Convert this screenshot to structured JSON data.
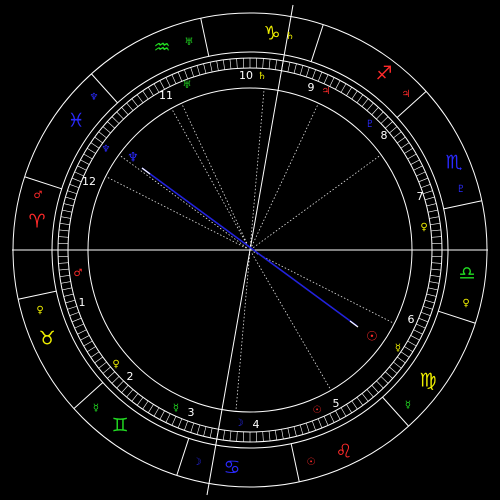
{
  "colors": {
    "background": "#000000",
    "lines": "#ffffff",
    "fire": "#ff2a2a",
    "earth": "#f0f000",
    "air": "#22dd22",
    "water": "#2a2aff",
    "aspect_opposition": "#2222dd"
  },
  "signs": [
    {
      "id": "aries",
      "glyph": "♈",
      "color": "#ff2a2a",
      "ruler": "♂",
      "ruler_color": "#ff2a2a"
    },
    {
      "id": "taurus",
      "glyph": "♉",
      "color": "#f0f000",
      "ruler": "♀",
      "ruler_color": "#f0f000"
    },
    {
      "id": "gemini",
      "glyph": "♊",
      "color": "#22dd22",
      "ruler": "☿",
      "ruler_color": "#22dd22"
    },
    {
      "id": "cancer",
      "glyph": "♋",
      "color": "#2a2aff",
      "ruler": "☽",
      "ruler_color": "#2a2aff"
    },
    {
      "id": "leo",
      "glyph": "♌",
      "color": "#ff2a2a",
      "ruler": "☉",
      "ruler_color": "#ff2a2a"
    },
    {
      "id": "virgo",
      "glyph": "♍",
      "color": "#f0f000",
      "ruler": "☿",
      "ruler_color": "#22dd22"
    },
    {
      "id": "libra",
      "glyph": "♎",
      "color": "#22dd22",
      "ruler": "♀",
      "ruler_color": "#f0f000"
    },
    {
      "id": "scorpio",
      "glyph": "♏",
      "color": "#2a2aff",
      "ruler": "♇",
      "ruler_color": "#2a2aff"
    },
    {
      "id": "sagittarius",
      "glyph": "♐",
      "color": "#ff2a2a",
      "ruler": "♃",
      "ruler_color": "#ff2a2a"
    },
    {
      "id": "capricorn",
      "glyph": "♑",
      "color": "#f0f000",
      "ruler": "♄",
      "ruler_color": "#f0f000"
    },
    {
      "id": "aquarius",
      "glyph": "♒",
      "color": "#22dd22",
      "ruler": "♅",
      "ruler_color": "#22dd22"
    },
    {
      "id": "pisces",
      "glyph": "♓",
      "color": "#2a2aff",
      "ruler": "♆",
      "ruler_color": "#2a2aff"
    }
  ],
  "houses": [
    {
      "num": "1",
      "ruler": "♂",
      "ruler_color": "#ff2a2a"
    },
    {
      "num": "2",
      "ruler": "♀",
      "ruler_color": "#f0f000"
    },
    {
      "num": "3",
      "ruler": "☿",
      "ruler_color": "#22dd22"
    },
    {
      "num": "4",
      "ruler": "☽",
      "ruler_color": "#2a2aff"
    },
    {
      "num": "5",
      "ruler": "☉",
      "ruler_color": "#ff2a2a"
    },
    {
      "num": "6",
      "ruler": "☿",
      "ruler_color": "#f0f000"
    },
    {
      "num": "7",
      "ruler": "♀",
      "ruler_color": "#22dd22"
    },
    {
      "num": "8",
      "ruler": "♇",
      "ruler_color": "#2a2aff"
    },
    {
      "num": "9",
      "ruler": "♃",
      "ruler_color": "#ff2a2a"
    },
    {
      "num": "10",
      "ruler": "♄",
      "ruler_color": "#f0f000"
    },
    {
      "num": "11",
      "ruler": "♅",
      "ruler_color": "#22dd22"
    },
    {
      "num": "12",
      "ruler": "♆",
      "ruler_color": "#2a2aff"
    }
  ],
  "planets": [
    {
      "id": "neptune",
      "glyph": "♆",
      "color": "#2a2aff"
    },
    {
      "id": "sun",
      "glyph": "☉",
      "color": "#ff2a2a"
    }
  ],
  "aspects": [
    {
      "from": "neptune",
      "to": "sun",
      "type": "opposition",
      "color": "#2222dd"
    }
  ]
}
